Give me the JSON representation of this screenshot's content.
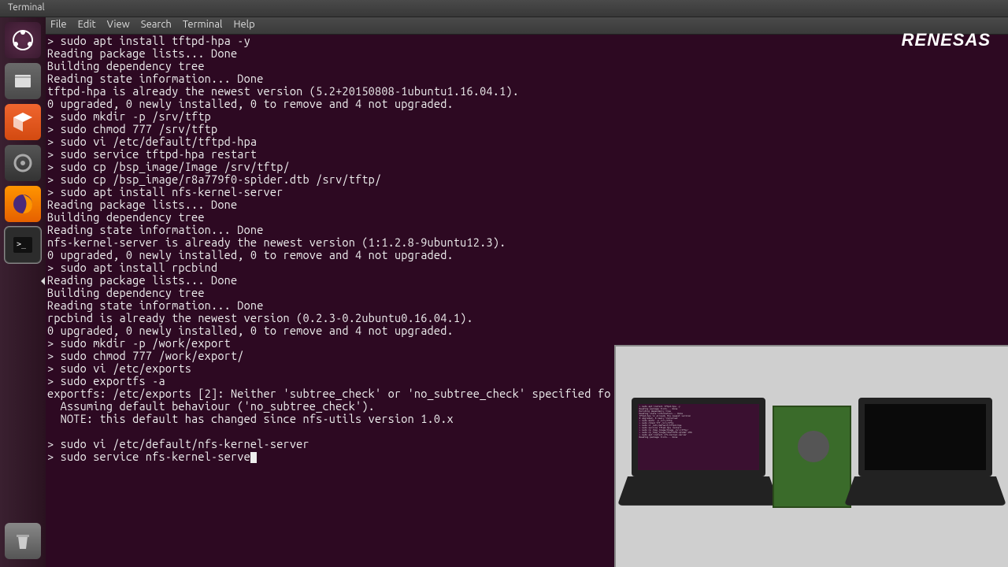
{
  "window": {
    "title": "Terminal"
  },
  "menubar": {
    "file": "File",
    "edit": "Edit",
    "view": "View",
    "search": "Search",
    "terminal": "Terminal",
    "help": "Help"
  },
  "logo": "RENESAS",
  "prompt": "> ",
  "terminal_lines": [
    "> sudo apt install tftpd-hpa -y",
    "Reading package lists... Done",
    "Building dependency tree",
    "Reading state information... Done",
    "tftpd-hpa is already the newest version (5.2+20150808-1ubuntu1.16.04.1).",
    "0 upgraded, 0 newly installed, 0 to remove and 4 not upgraded.",
    "> sudo mkdir -p /srv/tftp",
    "> sudo chmod 777 /srv/tftp",
    "> sudo vi /etc/default/tftpd-hpa",
    "> sudo service tftpd-hpa restart",
    "> sudo cp /bsp_image/Image /srv/tftp/",
    "> sudo cp /bsp_image/r8a779f0-spider.dtb /srv/tftp/",
    "> sudo apt install nfs-kernel-server",
    "Reading package lists... Done",
    "Building dependency tree",
    "Reading state information... Done",
    "nfs-kernel-server is already the newest version (1:1.2.8-9ubuntu12.3).",
    "0 upgraded, 0 newly installed, 0 to remove and 4 not upgraded.",
    "> sudo apt install rpcbind",
    "Reading package lists... Done",
    "Building dependency tree",
    "Reading state information... Done",
    "rpcbind is already the newest version (0.2.3-0.2ubuntu0.16.04.1).",
    "0 upgraded, 0 newly installed, 0 to remove and 4 not upgraded.",
    "> sudo mkdir -p /work/export",
    "> sudo chmod 777 /work/export/",
    "> sudo vi /etc/exports",
    "> sudo exportfs -a",
    "exportfs: /etc/exports [2]: Neither 'subtree_check' or 'no_subtree_check' specified fo",
    "  Assuming default behaviour ('no_subtree_check').",
    "  NOTE: this default has changed since nfs-utils version 1.0.x",
    "",
    "> sudo vi /etc/default/nfs-kernel-server",
    "> sudo service nfs-kernel-serve"
  ],
  "current_input": "sudo service nfs-kernel-serve"
}
